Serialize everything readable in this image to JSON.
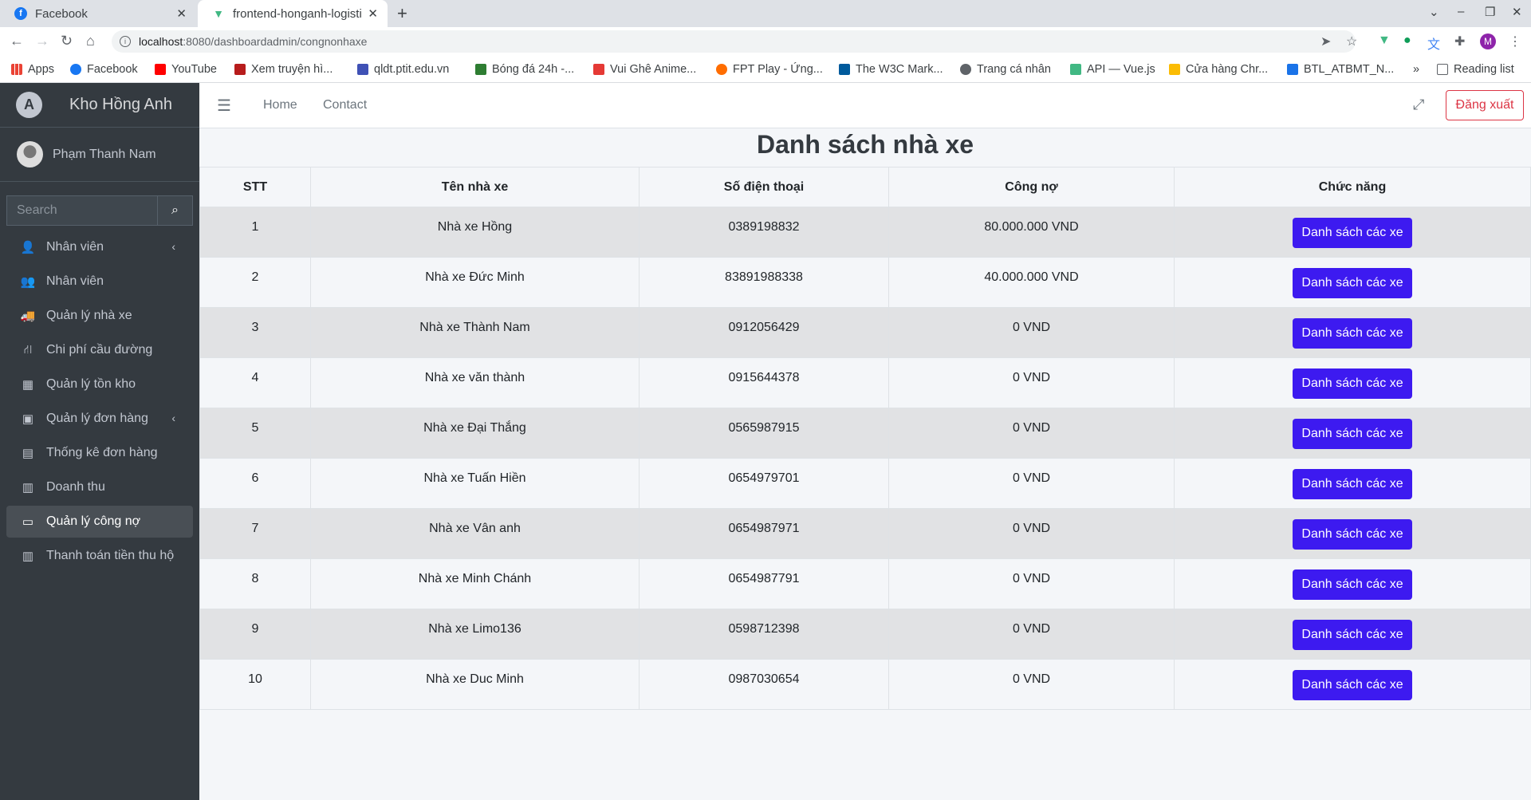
{
  "browser": {
    "tabs": [
      {
        "title": "Facebook",
        "active": false
      },
      {
        "title": "frontend-honganh-logisti",
        "active": true
      }
    ],
    "url_host": "localhost",
    "url_path": ":8080/dashboardadmin/congnonhaxe",
    "profile_initial": "M",
    "bookmarks": [
      "Apps",
      "Facebook",
      "YouTube",
      "Xem truyện hì...",
      "qldt.ptit.edu.vn",
      "Bóng đá 24h -...",
      "Vui Ghê Anime...",
      "FPT Play - Ứng...",
      "The W3C Mark...",
      "Trang cá nhân",
      "API — Vue.js",
      "Cửa hàng Chr...",
      "BTL_ATBMT_N...",
      "»",
      "Reading list"
    ]
  },
  "sidebar": {
    "brand": "Kho Hồng Anh",
    "user": "Phạm Thanh Nam",
    "search_placeholder": "Search",
    "items": [
      {
        "label": "Nhân viên",
        "icon": "user-icon",
        "has_chevron": true
      },
      {
        "label": "Nhân viên",
        "icon": "users-icon"
      },
      {
        "label": "Quản lý nhà xe",
        "icon": "truck-icon"
      },
      {
        "label": "Chi phí cầu đường",
        "icon": "road-icon"
      },
      {
        "label": "Quản lý tồn kho",
        "icon": "warehouse-icon"
      },
      {
        "label": "Quản lý đơn hàng",
        "icon": "calendar-check-icon",
        "has_chevron": true
      },
      {
        "label": "Thống kê đơn hàng",
        "icon": "table-icon"
      },
      {
        "label": "Doanh thu",
        "icon": "document-icon"
      },
      {
        "label": "Quản lý công nợ",
        "icon": "money-bill-icon",
        "active": true
      },
      {
        "label": "Thanh toán tiền thu hộ",
        "icon": "file-invoice-icon"
      }
    ]
  },
  "topnav": {
    "home": "Home",
    "contact": "Contact",
    "logout": "Đăng xuất"
  },
  "page": {
    "title": "Danh sách nhà xe",
    "columns": [
      "STT",
      "Tên nhà xe",
      "Số điện thoại",
      "Công nợ",
      "Chức năng"
    ],
    "action_label": "Danh sách các xe",
    "rows": [
      {
        "stt": "1",
        "name": "Nhà xe Hồng",
        "phone": "0389198832",
        "debt": "80.000.000 VND"
      },
      {
        "stt": "2",
        "name": "Nhà xe Đức Minh",
        "phone": "83891988338",
        "debt": "40.000.000 VND"
      },
      {
        "stt": "3",
        "name": "Nhà xe Thành Nam",
        "phone": "0912056429",
        "debt": "0 VND"
      },
      {
        "stt": "4",
        "name": "Nhà xe văn thành",
        "phone": "0915644378",
        "debt": "0 VND"
      },
      {
        "stt": "5",
        "name": "Nhà xe Đại Thắng",
        "phone": "0565987915",
        "debt": "0 VND"
      },
      {
        "stt": "6",
        "name": "Nhà xe Tuấn Hiền",
        "phone": "0654979701",
        "debt": "0 VND"
      },
      {
        "stt": "7",
        "name": "Nhà xe Vân anh",
        "phone": "0654987971",
        "debt": "0 VND"
      },
      {
        "stt": "8",
        "name": "Nhà xe Minh Chánh",
        "phone": "0654987791",
        "debt": "0 VND"
      },
      {
        "stt": "9",
        "name": "Nhà xe Limo136",
        "phone": "0598712398",
        "debt": "0 VND"
      },
      {
        "stt": "10",
        "name": "Nhà xe Duc Minh",
        "phone": "0987030654",
        "debt": "0 VND"
      }
    ]
  }
}
